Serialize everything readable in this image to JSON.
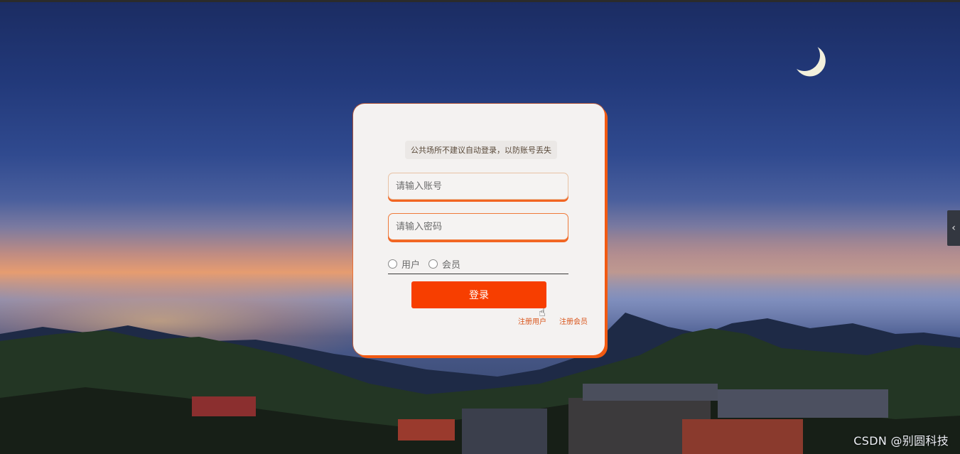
{
  "login": {
    "notice": "公共场所不建议自动登录，以防账号丢失",
    "account_placeholder": "请输入账号",
    "password_placeholder": "请输入密码",
    "role_options": [
      "用户",
      "会员"
    ],
    "login_label": "登录",
    "links": [
      "注册用户",
      "注册会员"
    ]
  },
  "side_tab": {
    "icon": "chevron-left-icon",
    "glyph": "‹"
  },
  "watermark": "CSDN @别圆科技",
  "colors": {
    "accent": "#f73e00",
    "card_border": "#f15a12",
    "link": "#d9541a"
  }
}
